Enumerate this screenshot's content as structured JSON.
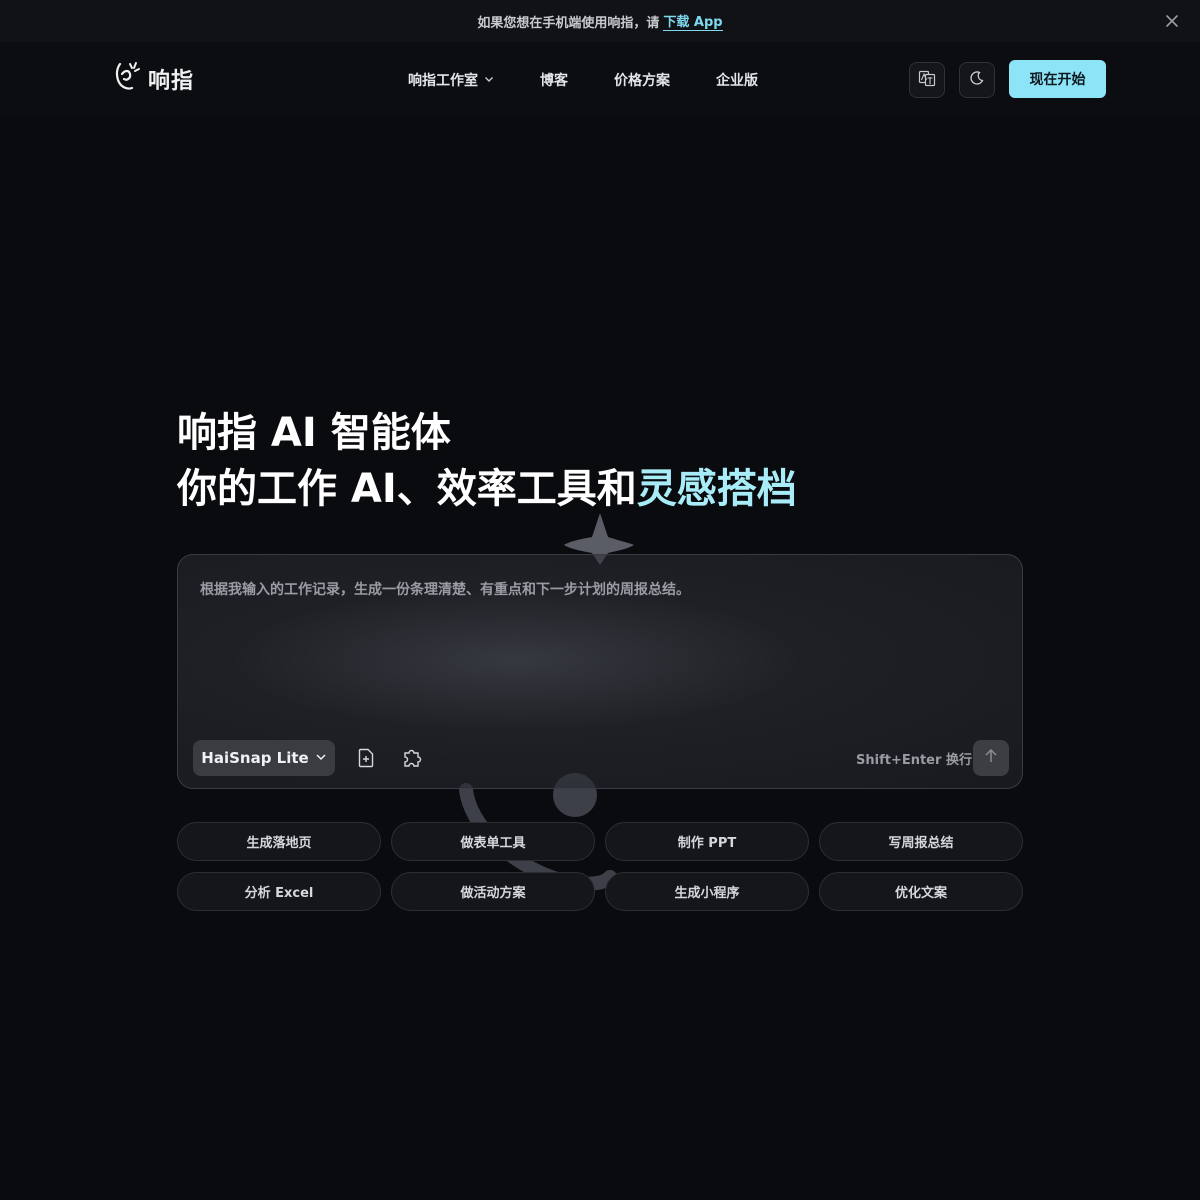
{
  "banner": {
    "text": "如果您想在手机端使用响指，请",
    "link": "下载 App"
  },
  "header": {
    "logo_text": "响指",
    "nav": [
      {
        "label": "响指工作室",
        "has_dropdown": true
      },
      {
        "label": "博客"
      },
      {
        "label": "价格方案"
      },
      {
        "label": "企业版"
      }
    ],
    "language_icon": "translate-icon",
    "theme_icon": "moon-icon",
    "cta_label": "现在开始"
  },
  "hero": {
    "line1": "响指 AI 智能体",
    "line2_main": "你的工作 AI、效率工具和",
    "line2_accent": "灵感搭档"
  },
  "composer": {
    "placeholder": "根据我输入的工作记录，生成一份条理清楚、有重点和下一步计划的周报总结。",
    "model": "HaiSnap Lite",
    "hint": "Shift+Enter 换行"
  },
  "chips": [
    "生成落地页",
    "做表单工具",
    "制作 PPT",
    "写周报总结",
    "分析 Excel",
    "做活动方案",
    "生成小程序",
    "优化文案"
  ],
  "colors": {
    "accent": "#8ee4f7",
    "background": "#0a0b0e"
  }
}
